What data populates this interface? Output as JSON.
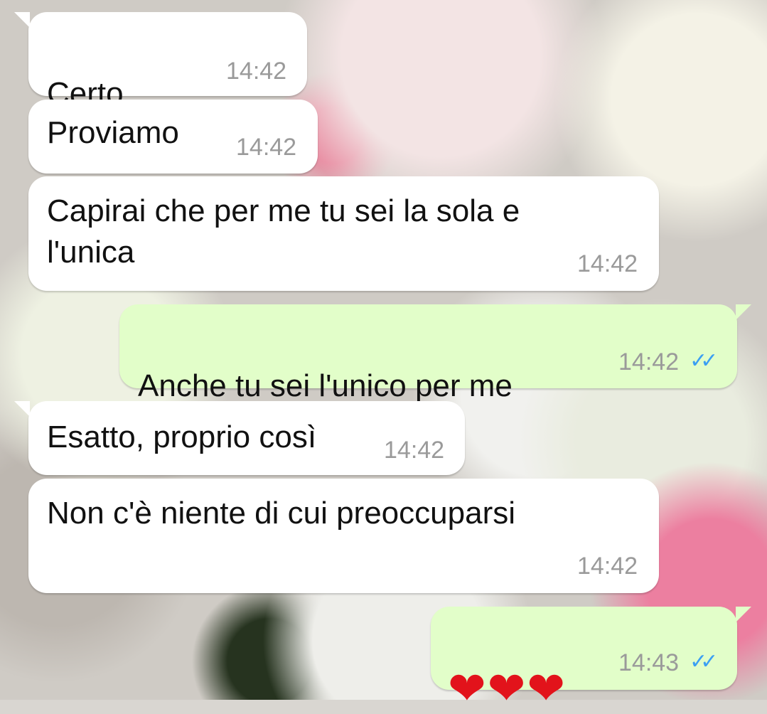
{
  "messages": [
    {
      "direction": "in",
      "text": "Certo",
      "emoji": "❤",
      "time": "14:42"
    },
    {
      "direction": "in",
      "text": "Proviamo",
      "time": "14:42"
    },
    {
      "direction": "in",
      "text": "Capirai che per me tu sei la sola e\nl'unica",
      "time": "14:42"
    },
    {
      "direction": "out",
      "text": "Anche tu sei l'unico per me",
      "emoji": "❤",
      "time": "14:42",
      "status": "read"
    },
    {
      "direction": "in",
      "text": "Esatto, proprio così",
      "time": "14:42"
    },
    {
      "direction": "in",
      "text": "Non c'è niente di cui preoccuparsi",
      "time": "14:42"
    },
    {
      "direction": "out",
      "emoji": "❤❤❤",
      "time": "14:43",
      "status": "read"
    }
  ],
  "colors": {
    "incoming_bubble": "#ffffff",
    "outgoing_bubble": "#e2fec9",
    "read_ticks": "#3b9ff3",
    "heart": "#e2131b"
  },
  "icons": {
    "read_receipt": "double-check-icon",
    "wallpaper": "floral-wallpaper"
  }
}
